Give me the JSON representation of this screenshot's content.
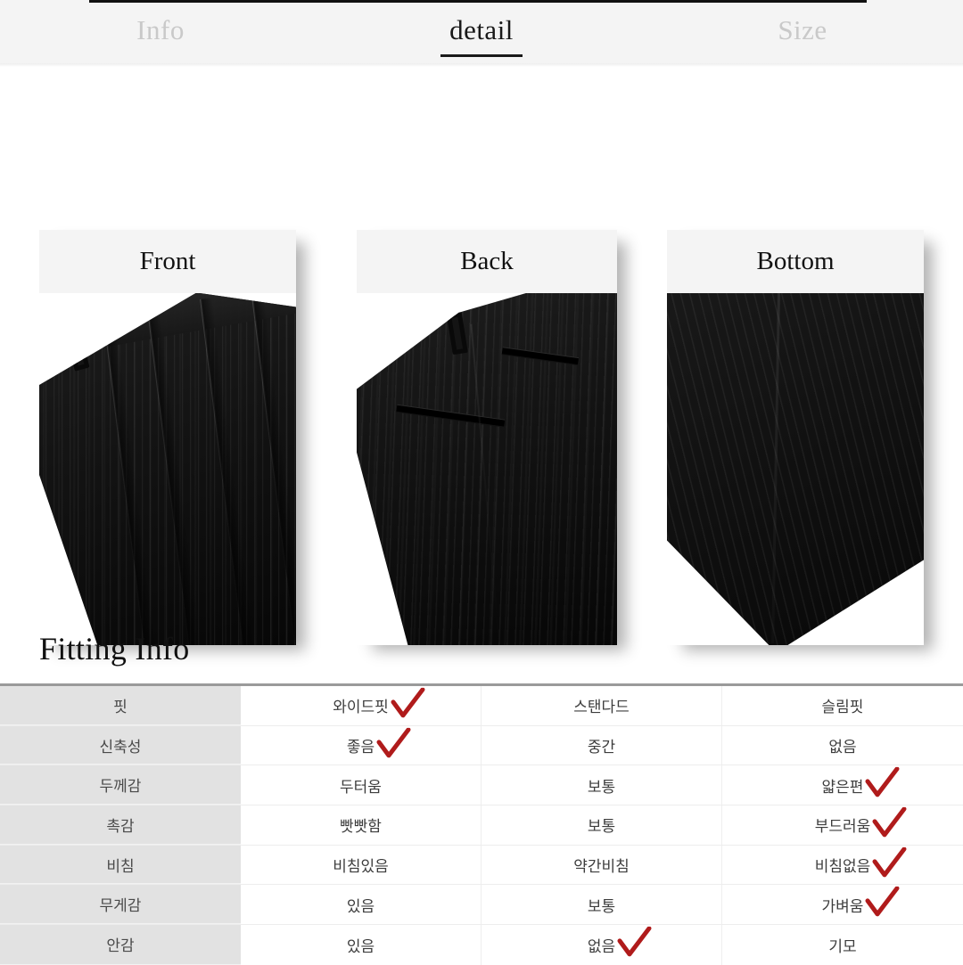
{
  "header": {
    "tabs": [
      {
        "label": "Info",
        "active": false
      },
      {
        "label": "detail",
        "active": true
      },
      {
        "label": "Size",
        "active": false
      }
    ]
  },
  "gallery": {
    "cards": [
      {
        "label": "Front",
        "image": "black-pinstripe-trousers-front-view"
      },
      {
        "label": "Back",
        "image": "black-pinstripe-trousers-back-view"
      },
      {
        "label": "Bottom",
        "image": "black-pinstripe-trousers-hem-view"
      }
    ]
  },
  "fitting": {
    "title": "Fitting Info",
    "check_color": "#B01B1B",
    "rows": [
      {
        "label": "핏",
        "options": [
          {
            "text": "와이드핏",
            "checked": true
          },
          {
            "text": "스탠다드",
            "checked": false
          },
          {
            "text": "슬림핏",
            "checked": false
          }
        ]
      },
      {
        "label": "신축성",
        "options": [
          {
            "text": "좋음",
            "checked": true
          },
          {
            "text": "중간",
            "checked": false
          },
          {
            "text": "없음",
            "checked": false
          }
        ]
      },
      {
        "label": "두께감",
        "options": [
          {
            "text": "두터움",
            "checked": false
          },
          {
            "text": "보통",
            "checked": false
          },
          {
            "text": "얇은편",
            "checked": true
          }
        ]
      },
      {
        "label": "촉감",
        "options": [
          {
            "text": "빳빳함",
            "checked": false
          },
          {
            "text": "보통",
            "checked": false
          },
          {
            "text": "부드러움",
            "checked": true
          }
        ]
      },
      {
        "label": "비침",
        "options": [
          {
            "text": "비침있음",
            "checked": false
          },
          {
            "text": "약간비침",
            "checked": false
          },
          {
            "text": "비침없음",
            "checked": true
          }
        ]
      },
      {
        "label": "무게감",
        "options": [
          {
            "text": "있음",
            "checked": false
          },
          {
            "text": "보통",
            "checked": false
          },
          {
            "text": "가벼움",
            "checked": true
          }
        ]
      },
      {
        "label": "안감",
        "options": [
          {
            "text": "있음",
            "checked": false
          },
          {
            "text": "없음",
            "checked": true
          },
          {
            "text": "기모",
            "checked": false
          }
        ]
      }
    ]
  }
}
